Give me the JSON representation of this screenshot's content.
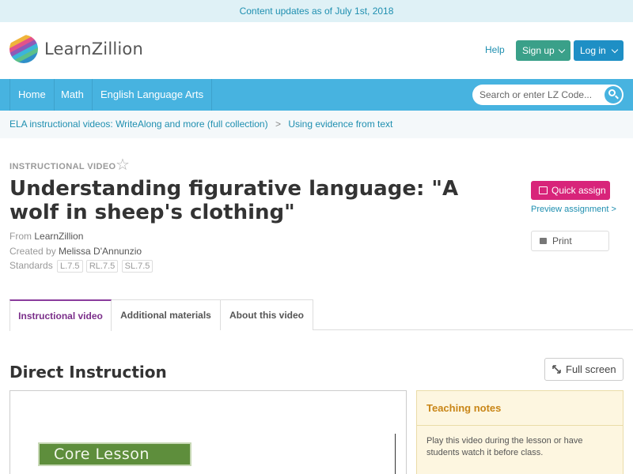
{
  "banner": {
    "text": "Content updates as of July 1st, 2018"
  },
  "header": {
    "logo_text": "LearnZillion",
    "help_label": "Help",
    "signup_label": "Sign up",
    "login_label": "Log in"
  },
  "nav": {
    "items": [
      {
        "label": "Home"
      },
      {
        "label": "Math"
      },
      {
        "label": "English Language Arts"
      }
    ],
    "search_placeholder": "Search or enter LZ Code..."
  },
  "breadcrumb": {
    "items": [
      {
        "label": "ELA instructional videos: WriteAlong and more (full collection)"
      },
      {
        "label": "Using evidence from text"
      }
    ],
    "separator": ">"
  },
  "lesson": {
    "type_label": "INSTRUCTIONAL VIDEO",
    "title": "Understanding figurative language: \"A wolf in sheep's clothing\"",
    "from_label": "From",
    "from_value": "LearnZillion",
    "created_label": "Created by",
    "created_value": "Melissa D'Annunzio",
    "standards_label": "Standards",
    "standards": [
      "L.7.5",
      "RL.7.5",
      "SL.7.5"
    ]
  },
  "actions": {
    "quick_assign_label": "Quick assign",
    "preview_label": "Preview assignment >",
    "print_label": "Print"
  },
  "tabs": [
    {
      "label": "Instructional video",
      "active": true
    },
    {
      "label": "Additional materials",
      "active": false
    },
    {
      "label": "About this video",
      "active": false
    }
  ],
  "content": {
    "section_title": "Direct Instruction",
    "fullscreen_label": "Full screen",
    "video_slide_label": "Core Lesson",
    "notes_title": "Teaching notes",
    "notes_body": "Play this video during the lesson or have students watch it before class."
  },
  "colors": {
    "nav_blue": "#47b3e0",
    "signup_green": "#3aa089",
    "login_blue": "#1e8fc5",
    "quick_assign_pink": "#d8247a",
    "active_tab_purple": "#7b2f8a",
    "notes_orange": "#c98618"
  }
}
